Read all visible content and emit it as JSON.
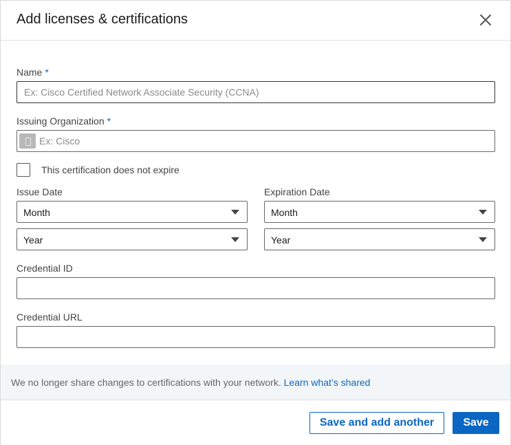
{
  "modal": {
    "title": "Add licenses & certifications"
  },
  "form": {
    "name": {
      "label": "Name",
      "required_mark": "*",
      "placeholder": "Ex: Cisco Certified Network Associate Security (CCNA)",
      "value": ""
    },
    "issuing_org": {
      "label": "Issuing Organization",
      "required_mark": "*",
      "placeholder": "Ex: Cisco",
      "value": ""
    },
    "no_expire": {
      "label": "This certification does not expire",
      "checked": false
    },
    "issue_date": {
      "label": "Issue Date",
      "month": "Month",
      "year": "Year"
    },
    "expiration_date": {
      "label": "Expiration Date",
      "month": "Month",
      "year": "Year"
    },
    "credential_id": {
      "label": "Credential ID",
      "value": ""
    },
    "credential_url": {
      "label": "Credential URL",
      "value": ""
    }
  },
  "info": {
    "text": "We no longer share changes to certifications with your network.",
    "link": "Learn what’s shared"
  },
  "footer": {
    "save_and_add": "Save and add another",
    "save": "Save"
  },
  "colors": {
    "accent": "#0a66c2",
    "info_bg": "#f3f6f8"
  },
  "icons": {
    "close": "close-icon",
    "org": "building-icon",
    "select_caret": "caret-down-icon"
  }
}
